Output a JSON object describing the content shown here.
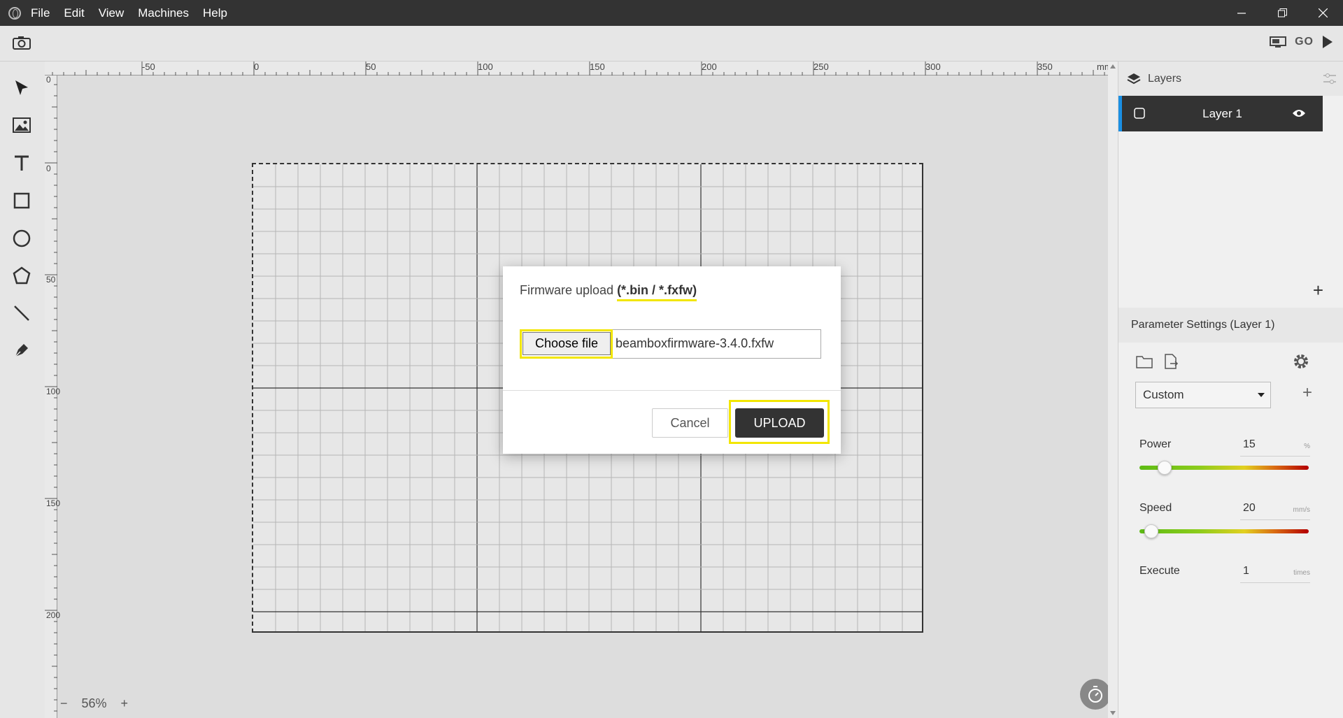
{
  "menu": [
    "File",
    "Edit",
    "View",
    "Machines",
    "Help"
  ],
  "toolbar": {
    "go_label": "GO"
  },
  "rulers": {
    "unit": "mm",
    "top_labels": [
      "-50",
      "0",
      "50",
      "100",
      "150",
      "200",
      "250",
      "300",
      "350"
    ],
    "left_labels": [
      "0",
      "0",
      "50",
      "100",
      "150",
      "200"
    ]
  },
  "canvas": {
    "zoom": "56%",
    "zoom_minus": "−",
    "zoom_plus": "+"
  },
  "layers": {
    "title": "Layers",
    "items": [
      {
        "name": "Layer 1",
        "active": true
      }
    ],
    "add": "+"
  },
  "params": {
    "title": "Parameter Settings (Layer 1)",
    "preset": "Custom",
    "preset_add": "+",
    "power": {
      "label": "Power",
      "value": "15",
      "unit": "%",
      "fraction": 0.15
    },
    "speed": {
      "label": "Speed",
      "value": "20",
      "unit": "mm/s",
      "fraction": 0.07
    },
    "execute": {
      "label": "Execute",
      "value": "1",
      "unit": "times"
    }
  },
  "modal": {
    "title_prefix": "Firmware upload ",
    "title_highlight": "(*.bin / *.fxfw)",
    "choose_label": "Choose file",
    "file_name": "beamboxfirmware-3.4.0.fxfw",
    "cancel_label": "Cancel",
    "upload_label": "UPLOAD"
  },
  "colors": {
    "highlight": "#f2e600",
    "accent": "#1a8fe3",
    "dark": "#333333"
  }
}
